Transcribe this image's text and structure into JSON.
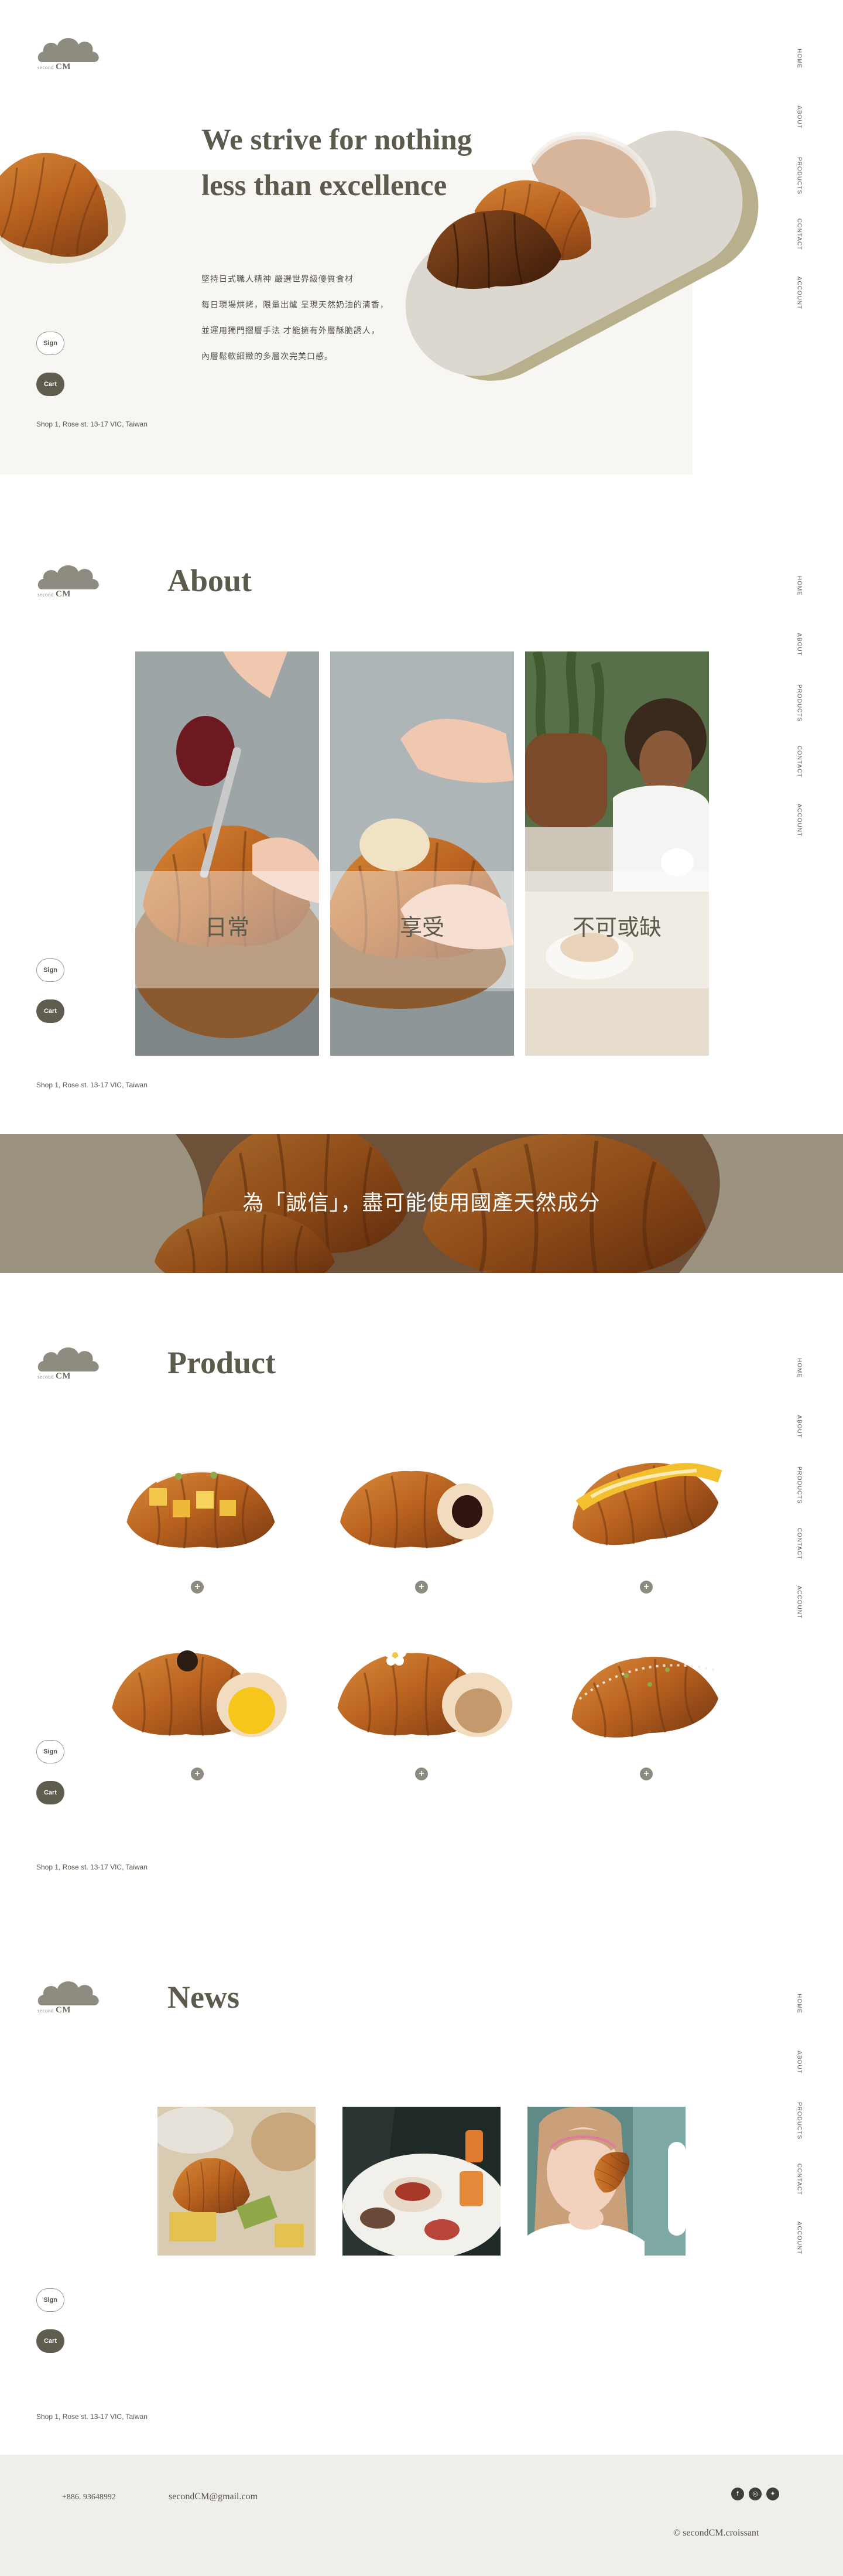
{
  "brand": {
    "logo_small": "second",
    "logo_big": "CM"
  },
  "nav": [
    "HOME",
    "ABOUT",
    "PRODUCTS",
    "CONTACT",
    "ACCOUNT"
  ],
  "buttons": {
    "sign": "Sign",
    "cart": "Cart"
  },
  "address": "Shop 1, Rose st. 13-17 VIC, Taiwan",
  "hero": {
    "title": "We strive for nothing less than excellence",
    "lines": [
      "堅持日式職人精神 嚴選世界級優質食材",
      "每日現場烘烤，限量出爐 呈現天然奶油的清香，",
      "並運用獨門摺層手法 才能擁有外層酥脆誘人，",
      "內層鬆軟細緻的多層次完美口感。"
    ]
  },
  "about": {
    "title": "About",
    "cards": [
      "日常",
      "享受",
      "不可或缺"
    ]
  },
  "banner": {
    "text": "為「誠信」，盡可能使用國產天然成分"
  },
  "products": {
    "title": "Product",
    "items": [
      {
        "name": "fruit-croissant",
        "add": "+"
      },
      {
        "name": "chocolate-croissant",
        "add": "+"
      },
      {
        "name": "mango-croissant",
        "add": "+"
      },
      {
        "name": "custard-croissant",
        "add": "+"
      },
      {
        "name": "caramel-croissant",
        "add": "+"
      },
      {
        "name": "pistachio-croissant",
        "add": "+"
      }
    ]
  },
  "news": {
    "title": "News"
  },
  "footer": {
    "phone": "+886. 93648992",
    "email": "secondCM@gmail.com",
    "copyright": "© secondCM.croissant",
    "social": [
      "facebook-icon",
      "instagram-icon",
      "twitter-icon"
    ]
  },
  "colors": {
    "accent": "#5c5a4c",
    "cart": "#5f5d50",
    "footer_bg": "#f0eeea",
    "hero_bg": "#f8f6f3"
  }
}
